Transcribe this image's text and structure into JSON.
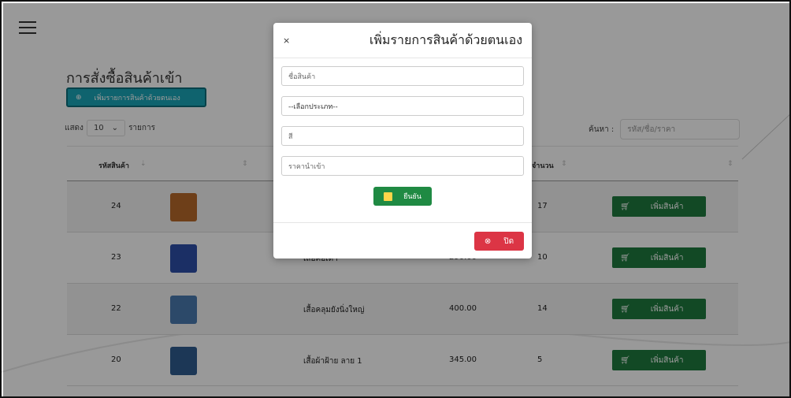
{
  "page": {
    "title": "การสั่งซื้อสินค้าเข้า",
    "manual_add_button": "เพิ่มรายการสินค้าด้วยตนเอง",
    "show_label": "แสดง",
    "show_value": "10",
    "show_suffix": "รายการ",
    "search_label": "ค้นหา :",
    "search_placeholder": "รหัส/ชื่อ/ราคา"
  },
  "table": {
    "headers": [
      "รหัสสินค้า",
      "จำนวน"
    ],
    "sort_glyphs": [
      "⇣",
      "⇕",
      "⇕",
      "⇕"
    ],
    "add_label": "เพิ่มสินค้า",
    "rows": [
      {
        "id": "24",
        "name": "",
        "price": "",
        "qty": "17",
        "thumb_color": "#b86a2a"
      },
      {
        "id": "23",
        "name": "เสื้อคอเต่า",
        "price": "290.00",
        "qty": "10",
        "thumb_color": "#2d4fa8"
      },
      {
        "id": "22",
        "name": "เสื้อคลุมยังนิ่งใหญ่",
        "price": "400.00",
        "qty": "14",
        "thumb_color": "#4a7bb0"
      },
      {
        "id": "20",
        "name": "เสื้อผ้าฝ้าย ลาย 1",
        "price": "345.00",
        "qty": "5",
        "thumb_color": "#2f5c8f"
      }
    ]
  },
  "modal": {
    "title": "เพิ่มรายการสินค้าด้วยตนเอง",
    "close_x": "×",
    "fields": {
      "name_placeholder": "ชื่อสินค้า",
      "category_value": "--เลือกประเภท--",
      "color_placeholder": "สี",
      "price_placeholder": "ราคานำเข้า"
    },
    "confirm_label": "ยืนยัน",
    "close_label": "ปิด"
  },
  "colors": {
    "accent_teal": "#1aa6b7",
    "confirm_green": "#1f8a43",
    "add_green": "#1f7a3e",
    "close_red": "#dc3545"
  }
}
